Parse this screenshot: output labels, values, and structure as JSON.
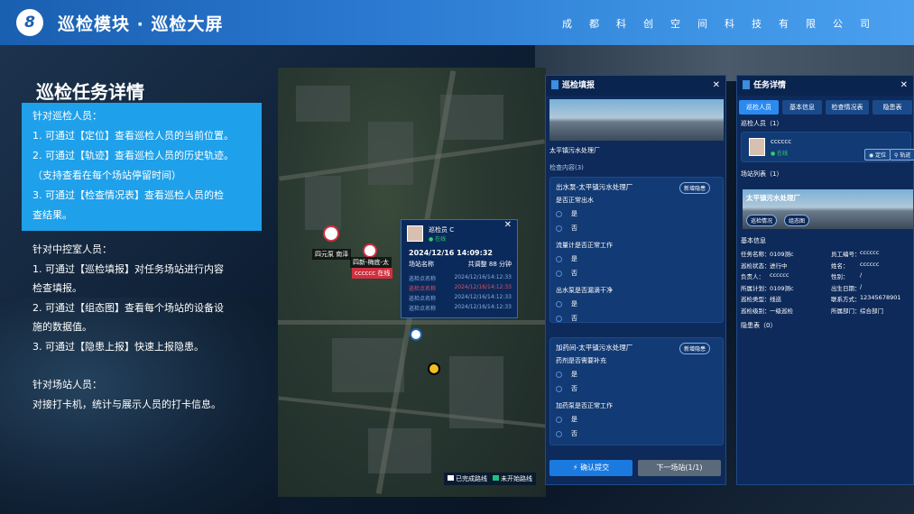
{
  "header": {
    "num": "8",
    "title": "巡检模块 · 巡检大屏",
    "company": "成都科创空间科技有限公司"
  },
  "section_title": "巡检任务详情",
  "highlight": [
    "针对巡检人员：",
    "1. 可通过【定位】查看巡检人员的当前位置。",
    "2. 可通过【轨迹】查看巡检人员的历史轨迹。",
    "（支持查看在每个场站停留时间）",
    "3. 可通过【检查情况表】查看巡检人员的检",
    "查结果。"
  ],
  "desc": [
    "针对中控室人员：",
    "1. 可通过【巡检填报】对任务场站进行内容",
    "检查填报。",
    "2. 可通过【组态图】查看每个场站的设备设",
    "施的数据值。",
    "3. 可通过【隐患上报】快速上报隐患。",
    "",
    "针对场站人员：",
    "对接打卡机，统计与展示人员的打卡信息。"
  ],
  "map": {
    "label_a": "四元泵 南泽",
    "label_b": "四新-梅底-太",
    "label_c": "cccccc 在线"
  },
  "popup": {
    "name": "巡检员 C",
    "status": "● 在线",
    "time": "2024/12/16 14:09:32",
    "site_label": "场站名称",
    "site_value": "共调整 88 分钟",
    "rows": [
      {
        "a": "巡检点名称",
        "b": "2024/12/16/14:12:33"
      },
      {
        "a": "巡检点名称",
        "b": "2024/12/16/14:12:33"
      },
      {
        "a": "巡检点名称",
        "b": "2024/12/16/14:12:33"
      },
      {
        "a": "巡检点名称",
        "b": "2024/12/16/14:12:33"
      }
    ]
  },
  "legend": {
    "a": "已完成路线",
    "b": "未开始路线"
  },
  "fill": {
    "title": "巡检填报",
    "plant": "太平镇污水处理厂",
    "check_count": "检查内容(3)",
    "card1": {
      "title": "出水泵-太平镇污水处理厂",
      "tag": "新增隐患",
      "q1": "是否正常出水",
      "q2": "流量计是否正常工作",
      "q3": "出水泵是否漏滴干净"
    },
    "card2": {
      "title": "加药间-太平镇污水处理厂",
      "tag": "新增隐患",
      "q1": "药剂是否需要补充",
      "q2": "加药泵是否正常工作"
    },
    "yes": "是",
    "no": "否",
    "submit": "⚡ 确认提交",
    "next": "下一场站(1/1)"
  },
  "task": {
    "title": "任务详情",
    "tabs": [
      "巡检人员",
      "基本信息",
      "检查情况表",
      "隐患表"
    ],
    "person_head": "巡检人员（1）",
    "person_name": "cccccc",
    "person_status": "● 在线",
    "locate": "定位",
    "track": "轨迹",
    "site_head": "场站列表（1）",
    "site_name": "太平镇污水处理厂",
    "site_btn1": "巡检情况",
    "site_btn2": "组态图",
    "basic_head": "基本信息",
    "info": [
      [
        "任务名称：",
        "0109测c",
        "员工编号：",
        "cccccc"
      ],
      [
        "巡检状态：",
        "进行中",
        "姓名：",
        "cccccc"
      ],
      [
        "负责人：",
        "cccccc",
        "性别：",
        "/"
      ],
      [
        "所属计划：",
        "0109测c",
        "出生日期：",
        "/"
      ],
      [
        "巡检类型：",
        "线巡",
        "联系方式：",
        "12345678901"
      ],
      [
        "巡检级别：",
        "一级巡检",
        "所属部门：",
        "综合部门"
      ]
    ],
    "hazard": "隐患表（0）"
  },
  "colors": {
    "accent": "#1fa0ea",
    "panel": "#0d2a5a"
  }
}
